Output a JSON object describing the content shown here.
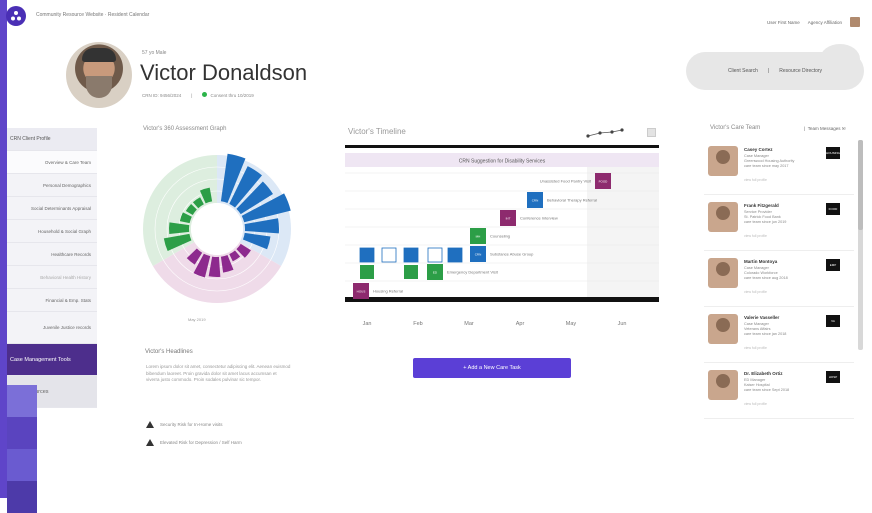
{
  "header": {
    "breadcrumb": "Community Resource Website · Resident Calendar",
    "user_name": "User First Name",
    "agency": "Agency Affiliation"
  },
  "profile": {
    "pre_name": "57 yo Male",
    "name": "Victor Donaldson",
    "id_text": "CRN ID: 9456/2024",
    "consent": "Consent thru 10/2019"
  },
  "top_buttons": {
    "client_search": "Client Search",
    "separator": "|",
    "resource_directory": "Resource Directory"
  },
  "sidebar": {
    "section_label": "CRN Client Profile",
    "items": [
      "Overview & Care Team",
      "Personal Demographics",
      "Social Determinants Appraisal",
      "Household & Social Graph",
      "Healthcare Records",
      "Behavioral Health History",
      "Financial & Emp. Stats",
      "Juvenile Justice records"
    ],
    "case_tools": "Case Management Tools",
    "find_resources": "Find Resources",
    "swatch_colors": [
      "#7b6fd8",
      "#5a44bf",
      "#6a5bd0",
      "#4d3aa9"
    ]
  },
  "graph": {
    "title": "Victor's 360 Assessment Graph",
    "date_label": "May 2019",
    "colors": {
      "green": "#2c9e47",
      "blue": "#1f6fbf",
      "purple": "#8d2a8e"
    }
  },
  "headlines": {
    "title": "Victor's Headlines",
    "body": "Lorem ipsum dolor sit amet, consectetur adipiscing elit. Aenean euismod bibendum laoreet. Proin gravida dolor sit amet lacus accumsan et viverra justo commodo. Proin sodales pulvinar sic tempor.",
    "alerts": [
      "Security Risk for In-Home visits",
      "Elevated Risk for Depression / Self Harm"
    ]
  },
  "timeline": {
    "title": "Victor's Timeline",
    "banner": "CRN Suggestion for Disability Services",
    "months": [
      "Jan",
      "Feb",
      "Mar",
      "Apr",
      "May",
      "Jun"
    ],
    "events": [
      {
        "label": "Unassisted Food Pantry Visit",
        "tag": "FOOD",
        "color": "#8d2a6e"
      },
      {
        "label": "Behavioral Therapy Referral",
        "tag": "CRN",
        "color": "#1f6fbf"
      },
      {
        "label": "Conference Interview",
        "tag": "INT",
        "color": "#8d2a6e"
      },
      {
        "label": "Counseling",
        "tag": "MH",
        "color": "#2c9e47"
      },
      {
        "label": "Substance Abuse Group",
        "tag": "CRN",
        "color": "#1f6fbf"
      },
      {
        "label": "Emergency Department Visit",
        "tag": "ED",
        "color": "#2c9e47"
      },
      {
        "label": "Housing Referral",
        "tag": "HOUS",
        "color": "#8d2a6e"
      }
    ],
    "add_button": "+ Add a New Care Task"
  },
  "care_team": {
    "title": "Victor's Care Team",
    "separator": "|",
    "messages_label": "Team Messages",
    "members": [
      {
        "name": "Casey Cortez",
        "role": "Case Manager",
        "org": "Greenwood Housing Authority",
        "since": "care team since may 2017",
        "link": "view full profile",
        "badge": "HOUSING"
      },
      {
        "name": "Frank Fitzgerald",
        "role": "Service Provider",
        "org": "St. Patrick Food Bank",
        "since": "care team since jun 2019",
        "link": "view full profile",
        "badge": "FOOD"
      },
      {
        "name": "Martin Montoya",
        "role": "Case Manager",
        "org": "Colorado Workforce",
        "since": "care team since aug 2018",
        "link": "view full profile",
        "badge": "EMP"
      },
      {
        "name": "Valerie Vasseller",
        "role": "Case Manager",
        "org": "Veterans Affairs",
        "since": "care team since jan 2018",
        "link": "view full profile",
        "badge": "VA"
      },
      {
        "name": "Dr. Elizabeth Ortiz",
        "role": "ED Manager",
        "org": "Kaiser Hospital",
        "since": "care team since Sept 2018",
        "link": "view full profile",
        "badge": "HOSP"
      }
    ]
  }
}
